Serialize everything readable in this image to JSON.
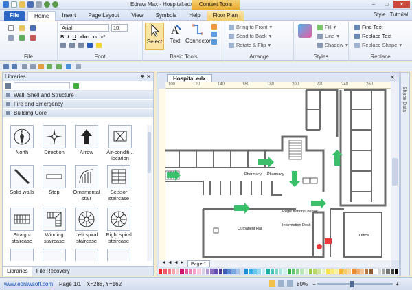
{
  "window": {
    "title": "Edraw Max - Hospital.edx",
    "context_tab": "Context Tools"
  },
  "menu": {
    "file": "File",
    "tabs": [
      "Home",
      "Insert",
      "Page Layout",
      "View",
      "Symbols",
      "Help",
      "Floor Plan"
    ],
    "style": "Style",
    "tutorial": "Tutorial"
  },
  "ribbon": {
    "file_group": "File",
    "font": {
      "name": "Arial",
      "size": "10",
      "group": "Font"
    },
    "basic_tools": {
      "select": "Select",
      "text": "Text",
      "connector": "Connector",
      "group": "Basic Tools"
    },
    "arrange": {
      "bring_front": "Bring to Front",
      "send_back": "Send to Back",
      "rotate_flip": "Rotate & Flip",
      "group": "Arrange"
    },
    "styles": {
      "fill": "Fill",
      "line": "Line",
      "shadow": "Shadow",
      "group": "Styles"
    },
    "replace": {
      "find_text": "Find Text",
      "replace_text": "Replace Text",
      "replace_shape": "Replace Shape",
      "group": "Replace"
    }
  },
  "libraries": {
    "title": "Libraries",
    "categories": [
      "Wall, Shell and Structure",
      "Fire and Emergency",
      "Building Core"
    ],
    "shapes": [
      {
        "label": "North"
      },
      {
        "label": "Direction"
      },
      {
        "label": "Arrow"
      },
      {
        "label": "Air-conditi... location"
      },
      {
        "label": "Solid walls"
      },
      {
        "label": "Step"
      },
      {
        "label": "Ornamental stair"
      },
      {
        "label": "Scissor staircase"
      },
      {
        "label": "Straight staircase"
      },
      {
        "label": "Winding staircase"
      },
      {
        "label": "Left spiral staircase"
      },
      {
        "label": "Right spiral staircase"
      }
    ],
    "footer_tabs": [
      "Libraries",
      "File Recovery"
    ]
  },
  "document": {
    "tab": "Hospital.edx",
    "page": "Page-1",
    "ruler_ticks": [
      "100",
      "120",
      "140",
      "160",
      "180",
      "200",
      "220",
      "240",
      "260"
    ],
    "side_label": "Shape Data",
    "labels": {
      "outpatient": "Outpatient Hall",
      "registration": "Regis tration Counter",
      "information": "Information Desk",
      "office": "Office",
      "pharmacy1": "Pharmacy",
      "pharmacy2": "Pharmacy"
    }
  },
  "palette": [
    "#ec2429",
    "#f05a6b",
    "#f47a8a",
    "#f9a3b0",
    "#fbc9d1",
    "#c9156e",
    "#e25a9b",
    "#e981b4",
    "#f2a5c8",
    "#f8cbe0",
    "#d9d0e8",
    "#b39ad3",
    "#8b6fc1",
    "#6752ab",
    "#4a3a93",
    "#3e5fb3",
    "#5a86cc",
    "#7ca6de",
    "#a4c3eb",
    "#cbe0f5",
    "#1e8fd2",
    "#39afe4",
    "#6cc7ec",
    "#9ad9f1",
    "#c7ebf8",
    "#1bb1a3",
    "#4bc6b8",
    "#7dd5ca",
    "#aee4dd",
    "#d4f1ed",
    "#3aae4b",
    "#68c26e",
    "#93d493",
    "#bee5bb",
    "#e0f2de",
    "#9cc93f",
    "#b9d86c",
    "#d2e798",
    "#e6f2c4",
    "#f6e24a",
    "#f9eb7f",
    "#fbf1a8",
    "#f7b731",
    "#f9c966",
    "#fbd994",
    "#f08d2e",
    "#f4a860",
    "#f7c395",
    "#b97b46",
    "#8e5c33",
    "#ffffff",
    "#d9d9d9",
    "#a6a6a6",
    "#737373",
    "#404040",
    "#000000"
  ],
  "status": {
    "website": "www.edrawsoft.com",
    "page": "Page 1/1",
    "coords": "X=288, Y=162",
    "zoom": "80%"
  }
}
